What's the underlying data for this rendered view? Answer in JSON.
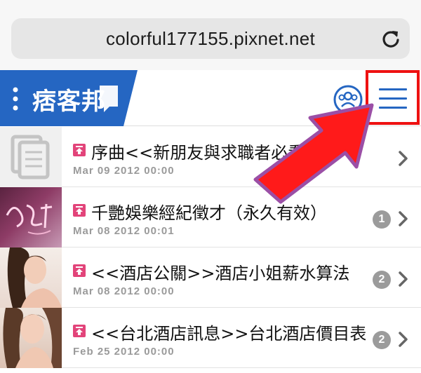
{
  "browser": {
    "url": "colorful177155.pixnet.net",
    "reload_icon": "reload-icon"
  },
  "header": {
    "logo_text": "痞客邦",
    "brand_color": "#2566c2",
    "profile_icon": "profile-group-icon",
    "menu_icon": "hamburger-menu-icon",
    "highlight_color": "#ee1111"
  },
  "articles": [
    {
      "title": "序曲<<新朋友與求職者必看>>",
      "date": "Mar 09 2012 00:00",
      "comments": "",
      "thumb": "document-placeholder"
    },
    {
      "title": "千艷娛樂經紀徵才（永久有效）",
      "date": "Mar 08 2012 00:01",
      "comments": "1",
      "thumb": "brand-calligraphy-image"
    },
    {
      "title": "<<酒店公關>>酒店小姐薪水算法",
      "date": "Mar 08 2012 00:00",
      "comments": "2",
      "thumb": "portrait-photo"
    },
    {
      "title": "<<台北酒店訊息>>台北酒店價目表",
      "date": "Feb 25 2012 00:00",
      "comments": "2",
      "thumb": "portrait-photo"
    }
  ],
  "annotation": {
    "arrow_color": "#ff1a1a",
    "arrow_border": "#9b4fa6"
  }
}
